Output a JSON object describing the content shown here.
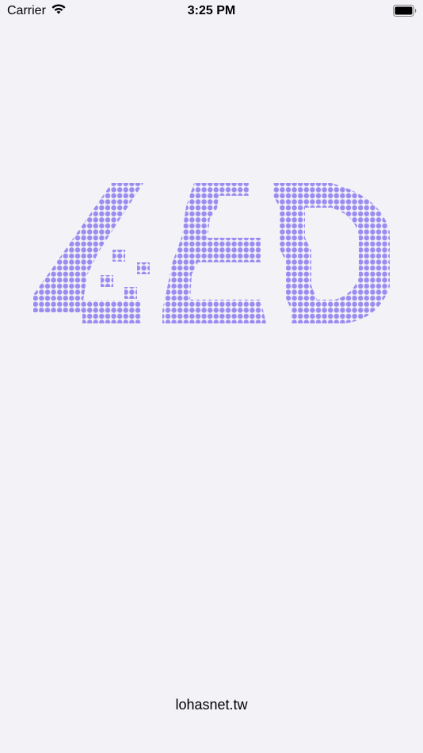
{
  "status_bar": {
    "carrier": "Carrier",
    "wifi_icon": "wifi-icon",
    "time": "3:25 PM",
    "battery_icon": "battery-icon"
  },
  "splash": {
    "logo_text": "LED",
    "logo_colors": {
      "top": "#9b8cf0",
      "bottom": "#5b47d6"
    }
  },
  "footer": {
    "website": "lohasnet.tw"
  }
}
